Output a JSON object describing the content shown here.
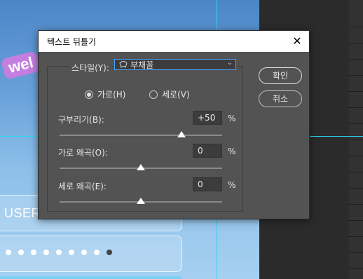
{
  "background": {
    "welcome_text": "wel",
    "user_field_text": "USER",
    "password_dot_count": 9
  },
  "dialog": {
    "title": "텍스트 뒤틀기",
    "style": {
      "label": "스타일(Y):",
      "selected": "부채꼴",
      "icon": "fan-arc-icon"
    },
    "orientation": {
      "horizontal_label": "가로(H)",
      "vertical_label": "세로(V)",
      "selected": "horizontal"
    },
    "bend": {
      "label": "구부리기(B):",
      "value": "+50",
      "unit": "%",
      "level": 50
    },
    "horizontal_distortion": {
      "label": "가로 왜곡(O):",
      "value": "0",
      "unit": "%",
      "level": 0
    },
    "vertical_distortion": {
      "label": "세로 왜곡(E):",
      "value": "0",
      "unit": "%",
      "level": 0
    },
    "ok_label": "확인",
    "cancel_label": "취소"
  },
  "colors": {
    "guide": "#30d5f0",
    "dialog_bg": "#535353",
    "select_focus": "#4aa3ff"
  }
}
